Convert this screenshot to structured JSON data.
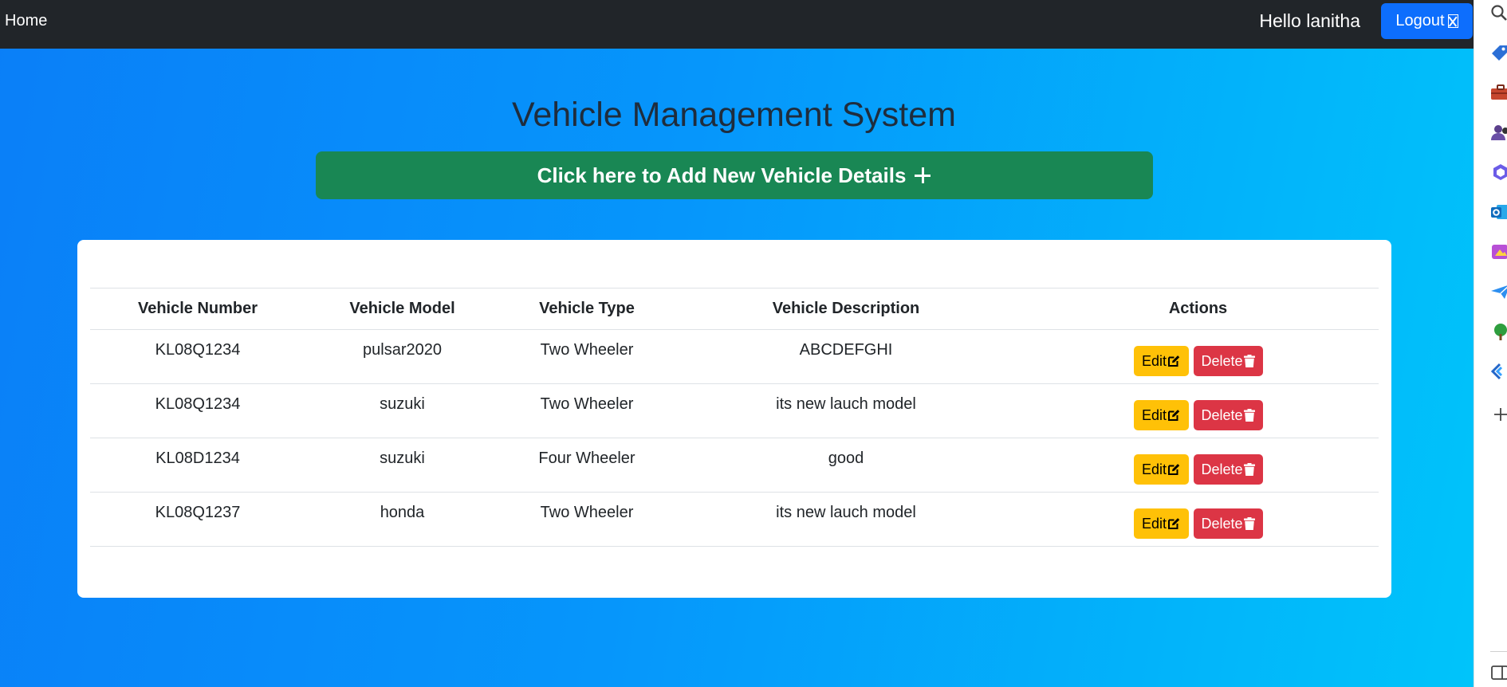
{
  "navbar": {
    "home_label": "Home",
    "greeting": "Hello lanitha",
    "logout_label": "Logout"
  },
  "page": {
    "title": "Vehicle Management System",
    "add_button_label": "Click here to Add New Vehicle Details"
  },
  "table": {
    "headers": [
      "Vehicle Number",
      "Vehicle Model",
      "Vehicle Type",
      "Vehicle Description",
      "Actions"
    ],
    "rows": [
      {
        "number": "KL08Q1234",
        "model": "pulsar2020",
        "type": "Two Wheeler",
        "description": "ABCDEFGHI"
      },
      {
        "number": "KL08Q1234",
        "model": "suzuki",
        "type": "Two Wheeler",
        "description": "its new lauch model"
      },
      {
        "number": "KL08D1234",
        "model": "suzuki",
        "type": "Four Wheeler",
        "description": "good"
      },
      {
        "number": "KL08Q1237",
        "model": "honda",
        "type": "Two Wheeler",
        "description": "its new lauch model"
      }
    ],
    "edit_label": "Edit",
    "delete_label": "Delete"
  },
  "sidebar_icons": [
    "search-icon",
    "tag-icon",
    "briefcase-icon",
    "people-icon",
    "copilot-icon",
    "outlook-icon",
    "designer-icon",
    "send-icon",
    "tree-icon",
    "app-icon",
    "plus-icon",
    "sidebar-toggle-icon"
  ],
  "colors": {
    "navbar_bg": "#212529",
    "logout_bg": "#0d6efd",
    "add_button_bg": "#198754",
    "edit_bg": "#ffc107",
    "delete_bg": "#dc3545",
    "gradient_start": "#0a7ff8",
    "gradient_end": "#00c4fa"
  }
}
